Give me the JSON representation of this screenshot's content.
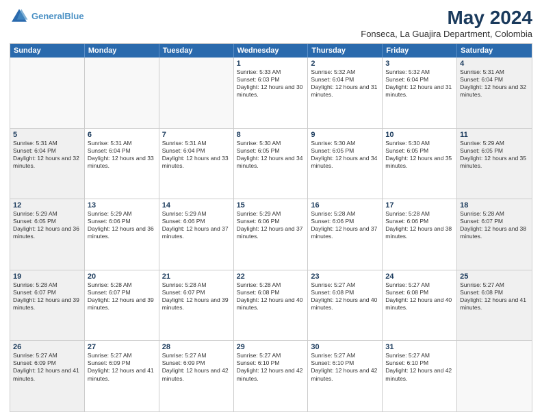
{
  "header": {
    "logo_line1": "General",
    "logo_line2": "Blue",
    "month_year": "May 2024",
    "location": "Fonseca, La Guajira Department, Colombia"
  },
  "days_of_week": [
    "Sunday",
    "Monday",
    "Tuesday",
    "Wednesday",
    "Thursday",
    "Friday",
    "Saturday"
  ],
  "weeks": [
    [
      {
        "day": "",
        "empty": true
      },
      {
        "day": "",
        "empty": true
      },
      {
        "day": "",
        "empty": true
      },
      {
        "day": "1",
        "sunrise": "5:33 AM",
        "sunset": "6:03 PM",
        "daylight": "12 hours and 30 minutes."
      },
      {
        "day": "2",
        "sunrise": "5:32 AM",
        "sunset": "6:04 PM",
        "daylight": "12 hours and 31 minutes."
      },
      {
        "day": "3",
        "sunrise": "5:32 AM",
        "sunset": "6:04 PM",
        "daylight": "12 hours and 31 minutes."
      },
      {
        "day": "4",
        "sunrise": "5:31 AM",
        "sunset": "6:04 PM",
        "daylight": "12 hours and 32 minutes."
      }
    ],
    [
      {
        "day": "5",
        "sunrise": "5:31 AM",
        "sunset": "6:04 PM",
        "daylight": "12 hours and 32 minutes."
      },
      {
        "day": "6",
        "sunrise": "5:31 AM",
        "sunset": "6:04 PM",
        "daylight": "12 hours and 33 minutes."
      },
      {
        "day": "7",
        "sunrise": "5:31 AM",
        "sunset": "6:04 PM",
        "daylight": "12 hours and 33 minutes."
      },
      {
        "day": "8",
        "sunrise": "5:30 AM",
        "sunset": "6:05 PM",
        "daylight": "12 hours and 34 minutes."
      },
      {
        "day": "9",
        "sunrise": "5:30 AM",
        "sunset": "6:05 PM",
        "daylight": "12 hours and 34 minutes."
      },
      {
        "day": "10",
        "sunrise": "5:30 AM",
        "sunset": "6:05 PM",
        "daylight": "12 hours and 35 minutes."
      },
      {
        "day": "11",
        "sunrise": "5:29 AM",
        "sunset": "6:05 PM",
        "daylight": "12 hours and 35 minutes."
      }
    ],
    [
      {
        "day": "12",
        "sunrise": "5:29 AM",
        "sunset": "6:05 PM",
        "daylight": "12 hours and 36 minutes."
      },
      {
        "day": "13",
        "sunrise": "5:29 AM",
        "sunset": "6:06 PM",
        "daylight": "12 hours and 36 minutes."
      },
      {
        "day": "14",
        "sunrise": "5:29 AM",
        "sunset": "6:06 PM",
        "daylight": "12 hours and 37 minutes."
      },
      {
        "day": "15",
        "sunrise": "5:29 AM",
        "sunset": "6:06 PM",
        "daylight": "12 hours and 37 minutes."
      },
      {
        "day": "16",
        "sunrise": "5:28 AM",
        "sunset": "6:06 PM",
        "daylight": "12 hours and 37 minutes."
      },
      {
        "day": "17",
        "sunrise": "5:28 AM",
        "sunset": "6:06 PM",
        "daylight": "12 hours and 38 minutes."
      },
      {
        "day": "18",
        "sunrise": "5:28 AM",
        "sunset": "6:07 PM",
        "daylight": "12 hours and 38 minutes."
      }
    ],
    [
      {
        "day": "19",
        "sunrise": "5:28 AM",
        "sunset": "6:07 PM",
        "daylight": "12 hours and 39 minutes."
      },
      {
        "day": "20",
        "sunrise": "5:28 AM",
        "sunset": "6:07 PM",
        "daylight": "12 hours and 39 minutes."
      },
      {
        "day": "21",
        "sunrise": "5:28 AM",
        "sunset": "6:07 PM",
        "daylight": "12 hours and 39 minutes."
      },
      {
        "day": "22",
        "sunrise": "5:28 AM",
        "sunset": "6:08 PM",
        "daylight": "12 hours and 40 minutes."
      },
      {
        "day": "23",
        "sunrise": "5:27 AM",
        "sunset": "6:08 PM",
        "daylight": "12 hours and 40 minutes."
      },
      {
        "day": "24",
        "sunrise": "5:27 AM",
        "sunset": "6:08 PM",
        "daylight": "12 hours and 40 minutes."
      },
      {
        "day": "25",
        "sunrise": "5:27 AM",
        "sunset": "6:08 PM",
        "daylight": "12 hours and 41 minutes."
      }
    ],
    [
      {
        "day": "26",
        "sunrise": "5:27 AM",
        "sunset": "6:09 PM",
        "daylight": "12 hours and 41 minutes."
      },
      {
        "day": "27",
        "sunrise": "5:27 AM",
        "sunset": "6:09 PM",
        "daylight": "12 hours and 41 minutes."
      },
      {
        "day": "28",
        "sunrise": "5:27 AM",
        "sunset": "6:09 PM",
        "daylight": "12 hours and 42 minutes."
      },
      {
        "day": "29",
        "sunrise": "5:27 AM",
        "sunset": "6:10 PM",
        "daylight": "12 hours and 42 minutes."
      },
      {
        "day": "30",
        "sunrise": "5:27 AM",
        "sunset": "6:10 PM",
        "daylight": "12 hours and 42 minutes."
      },
      {
        "day": "31",
        "sunrise": "5:27 AM",
        "sunset": "6:10 PM",
        "daylight": "12 hours and 42 minutes."
      },
      {
        "day": "",
        "empty": true
      }
    ]
  ]
}
